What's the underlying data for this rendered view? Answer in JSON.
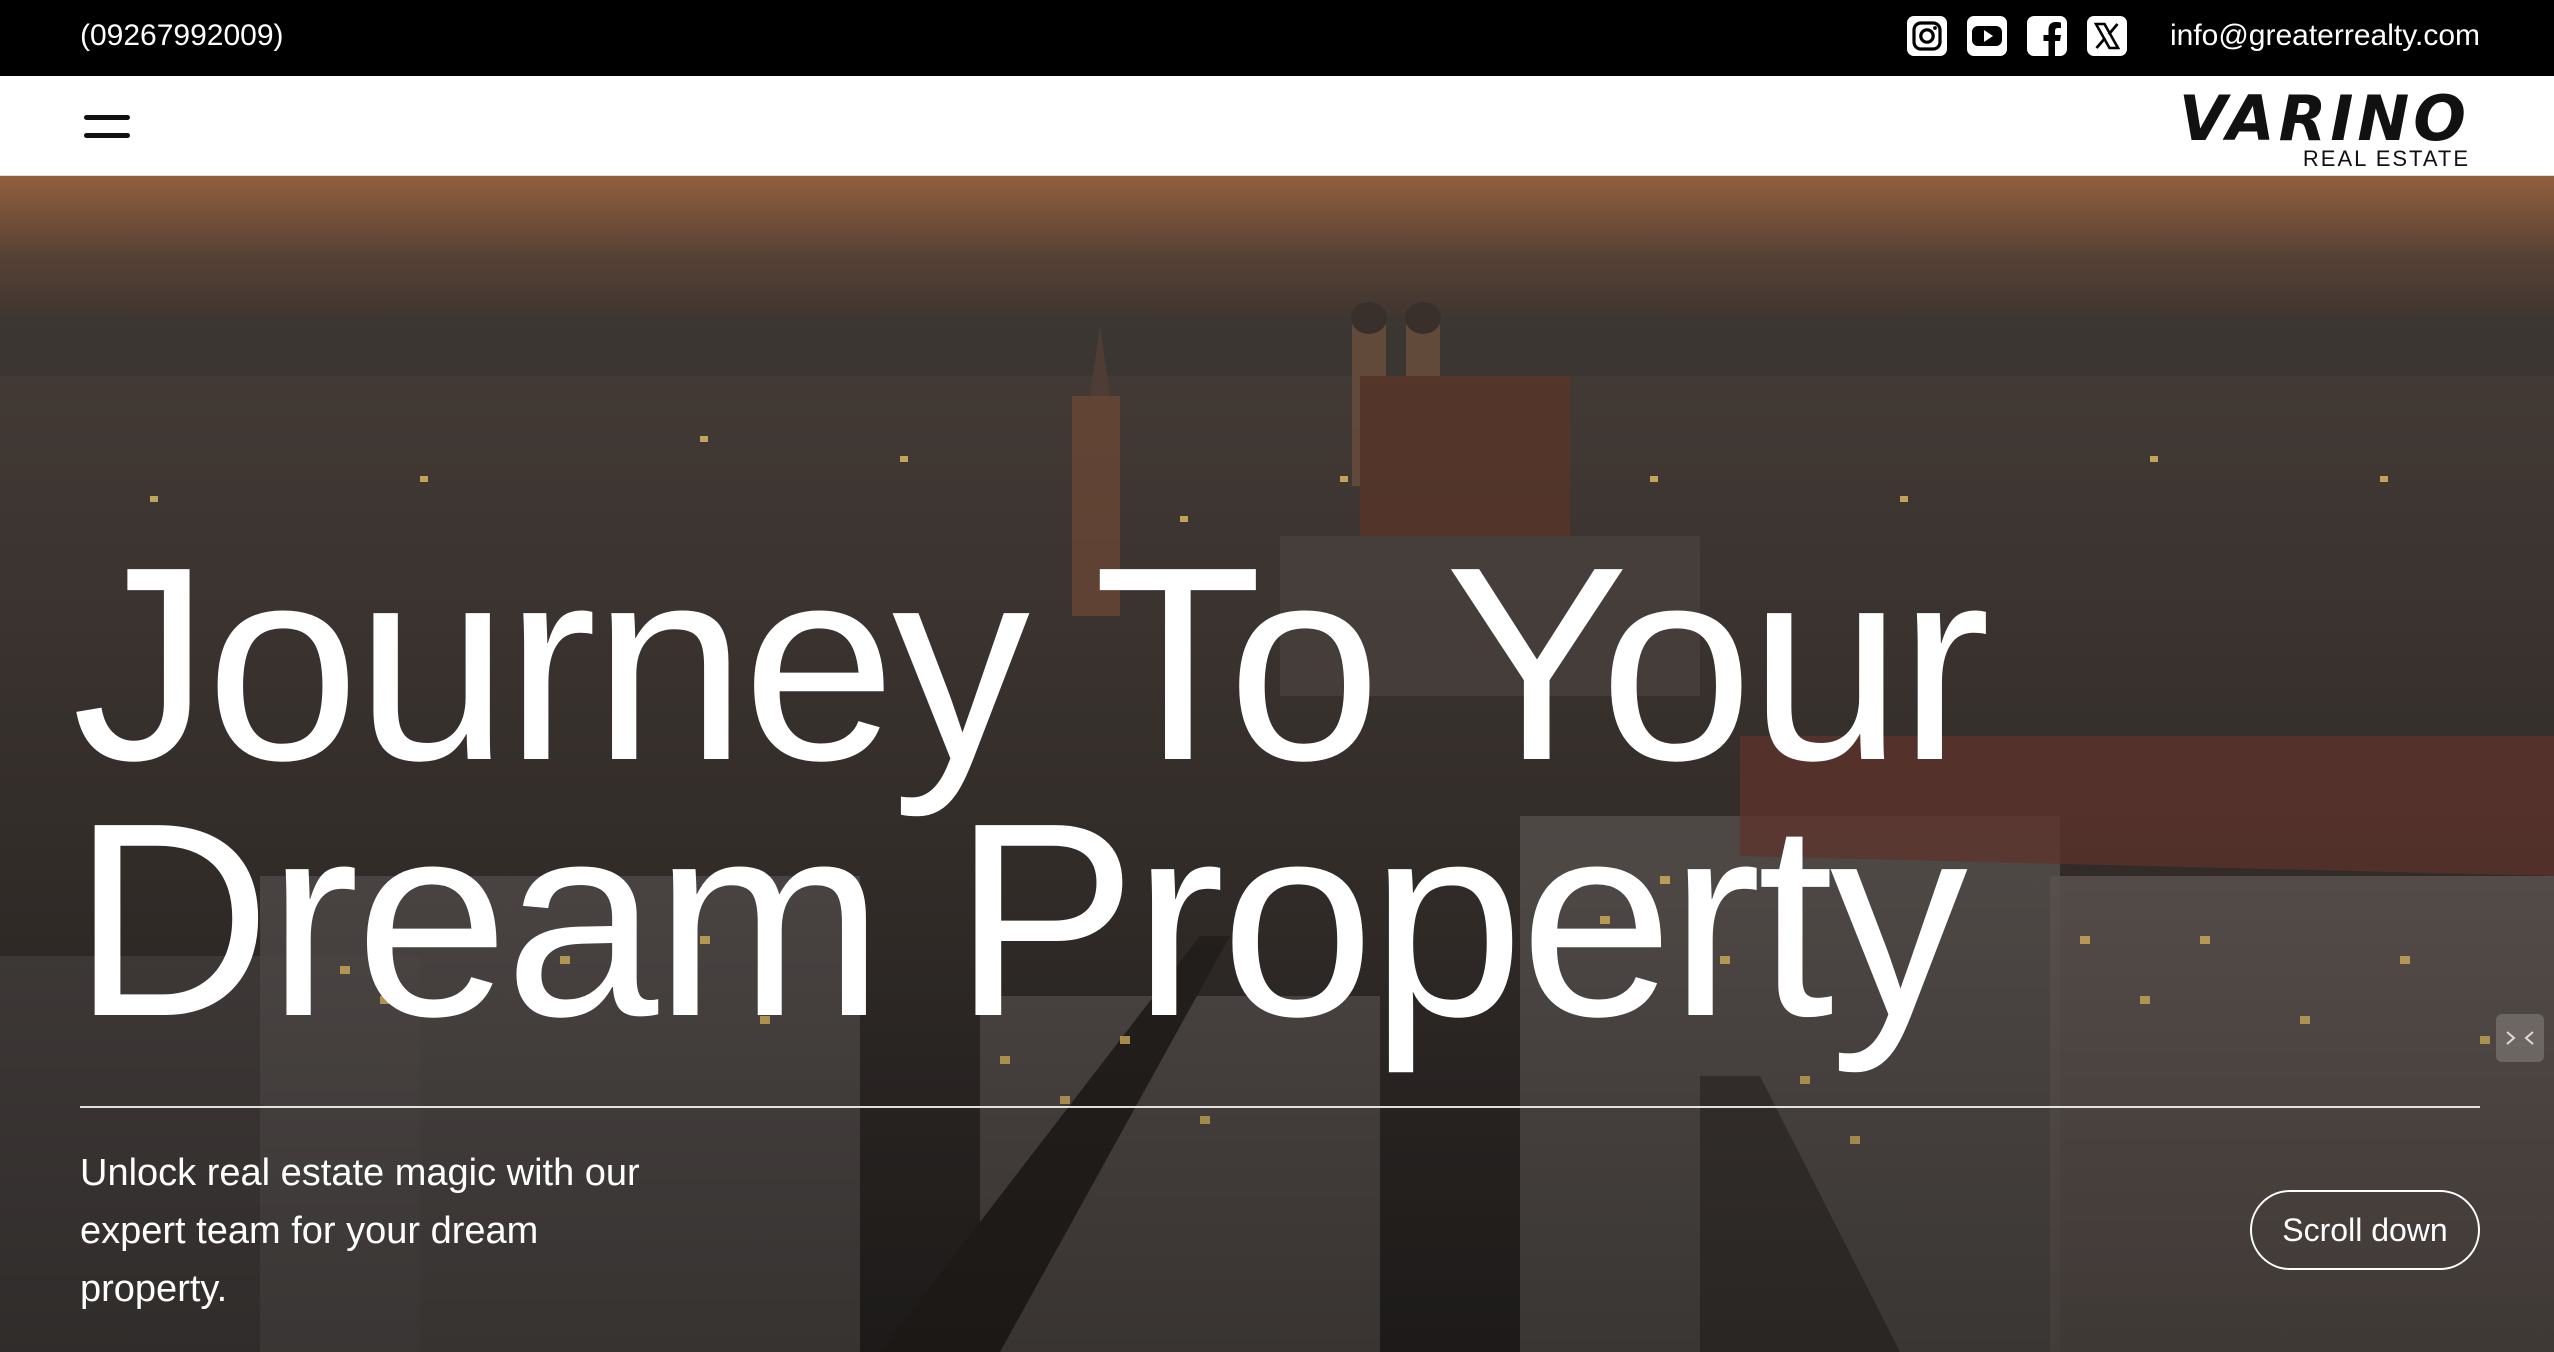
{
  "topbar": {
    "phone": "(09267992009)",
    "email": "info@greaterrealty.com",
    "socials": [
      {
        "icon": "instagram-icon"
      },
      {
        "icon": "youtube-icon"
      },
      {
        "icon": "facebook-icon"
      },
      {
        "icon": "x-icon"
      }
    ]
  },
  "navbar": {
    "menu_icon": "hamburger-menu-icon",
    "logo": {
      "brand": "VARINO",
      "subtitle": "REAL ESTATE"
    }
  },
  "hero": {
    "headline_line1": "Journey To Your",
    "headline_line2": "Dream Property",
    "tagline": "Unlock real estate magic with our expert team for your dream property.",
    "scroll_label": "Scroll down",
    "side_widget_icon": "collapse-arrows-icon"
  },
  "colors": {
    "topbar_bg": "#000000",
    "navbar_bg": "#ffffff",
    "hero_text": "#ffffff"
  }
}
